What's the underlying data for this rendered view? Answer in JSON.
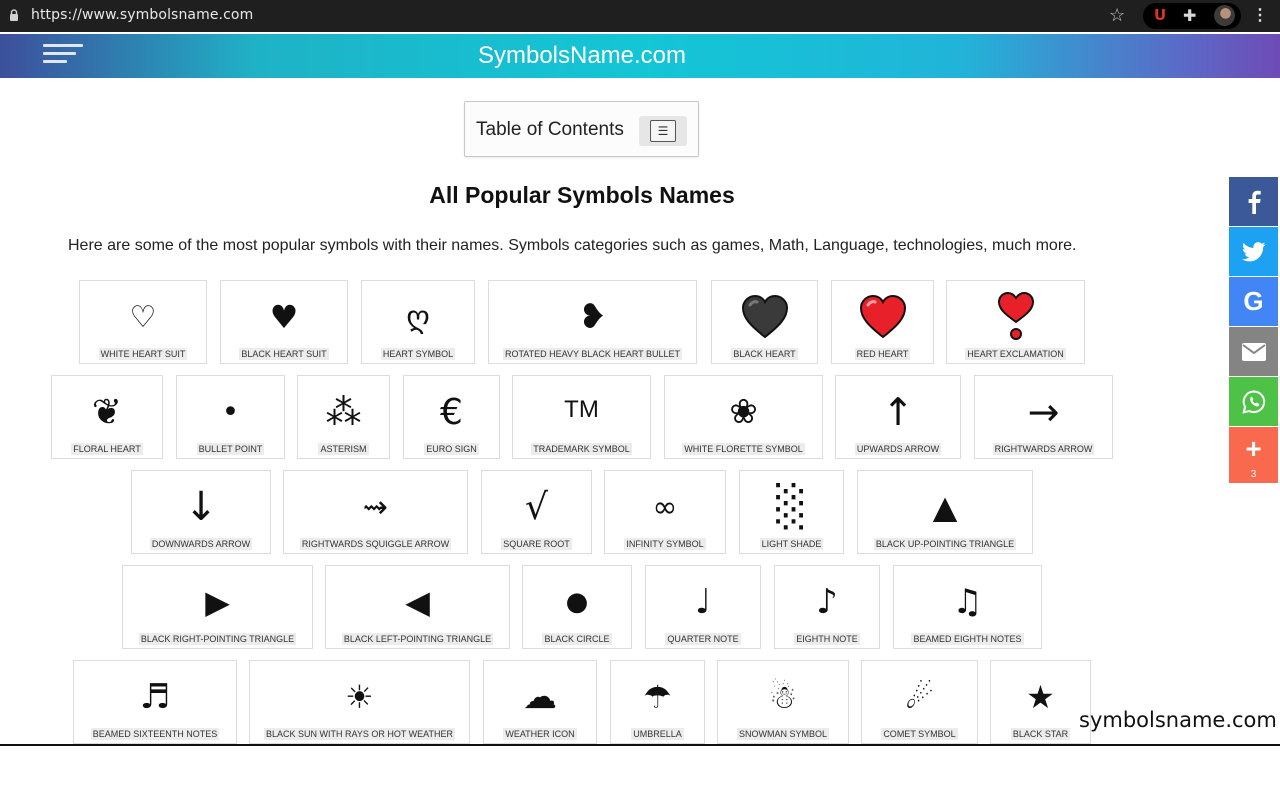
{
  "browser": {
    "url": "https://www.symbolsname.com",
    "icons": [
      "lock-icon",
      "star-icon",
      "ublock-icon",
      "puzzle-icon",
      "avatar",
      "kebab-menu-icon"
    ]
  },
  "header": {
    "title": "SymbolsName.com",
    "icon": "hamburger-menu-icon"
  },
  "toc": {
    "label": "Table of Contents",
    "toggle_glyph": "☰"
  },
  "main": {
    "heading": "All Popular Symbols Names",
    "intro": "Here are some of the most popular symbols with their names. Symbols categories such as games, Math, Language, technologies, much more.",
    "symbols": [
      {
        "symbol": "♡",
        "name": "WHITE HEART SUIT"
      },
      {
        "symbol": "♥",
        "name": "BLACK HEART SUIT"
      },
      {
        "symbol": "ღ",
        "name": "HEART SYMBOL"
      },
      {
        "symbol": "❥",
        "name": "ROTATED HEAVY BLACK HEART BULLET"
      },
      {
        "symbol": "🖤",
        "name": "BLACK HEART"
      },
      {
        "symbol": "❤️",
        "name": "RED HEART"
      },
      {
        "symbol": "❣️",
        "name": "HEART EXCLAMATION"
      },
      {
        "symbol": "❦",
        "name": "FLORAL HEART"
      },
      {
        "symbol": "•",
        "name": "BULLET POINT"
      },
      {
        "symbol": "⁂",
        "name": "ASTERISM"
      },
      {
        "symbol": "€",
        "name": "EURO SIGN"
      },
      {
        "symbol": "TM",
        "name": "TRADEMARK SYMBOL"
      },
      {
        "symbol": "❀",
        "name": "WHITE FLORETTE SYMBOL"
      },
      {
        "symbol": "↑",
        "name": "UPWARDS ARROW"
      },
      {
        "symbol": "→",
        "name": "RIGHTWARDS ARROW"
      },
      {
        "symbol": "↓",
        "name": "DOWNWARDS ARROW"
      },
      {
        "symbol": "⇝",
        "name": "RIGHTWARDS SQUIGGLE ARROW"
      },
      {
        "symbol": "√",
        "name": "SQUARE ROOT"
      },
      {
        "symbol": "∞",
        "name": "INFINITY SYMBOL"
      },
      {
        "symbol": "░",
        "name": "LIGHT SHADE"
      },
      {
        "symbol": "▲",
        "name": "BLACK UP-POINTING TRIANGLE"
      },
      {
        "symbol": "▶",
        "name": "BLACK RIGHT-POINTING TRIANGLE"
      },
      {
        "symbol": "◀",
        "name": "BLACK LEFT-POINTING TRIANGLE"
      },
      {
        "symbol": "●",
        "name": "BLACK CIRCLE"
      },
      {
        "symbol": "♩",
        "name": "QUARTER NOTE"
      },
      {
        "symbol": "♪",
        "name": "EIGHTH NOTE"
      },
      {
        "symbol": "♫",
        "name": "BEAMED EIGHTH NOTES"
      },
      {
        "symbol": "♬",
        "name": "BEAMED SIXTEENTH NOTES"
      },
      {
        "symbol": "☀",
        "name": "BLACK SUN WITH RAYS OR HOT WEATHER"
      },
      {
        "symbol": "☁",
        "name": "WEATHER ICON"
      },
      {
        "symbol": "☂",
        "name": "UMBRELLA"
      },
      {
        "symbol": "☃",
        "name": "SNOWMAN SYMBOL"
      },
      {
        "symbol": "☄",
        "name": "COMET SYMBOL"
      },
      {
        "symbol": "★",
        "name": "BLACK STAR"
      }
    ]
  },
  "share": {
    "buttons": [
      {
        "icon": "facebook-icon",
        "color": "#3b5998"
      },
      {
        "icon": "twitter-icon",
        "color": "#1da1f2"
      },
      {
        "icon": "google-icon",
        "color": "#4285f4"
      },
      {
        "icon": "email-icon",
        "color": "#848484"
      },
      {
        "icon": "whatsapp-icon",
        "color": "#4dc247"
      },
      {
        "icon": "plus-icon",
        "color": "#f8694d"
      }
    ],
    "count": "3"
  },
  "watermark": "symbolsname.com"
}
